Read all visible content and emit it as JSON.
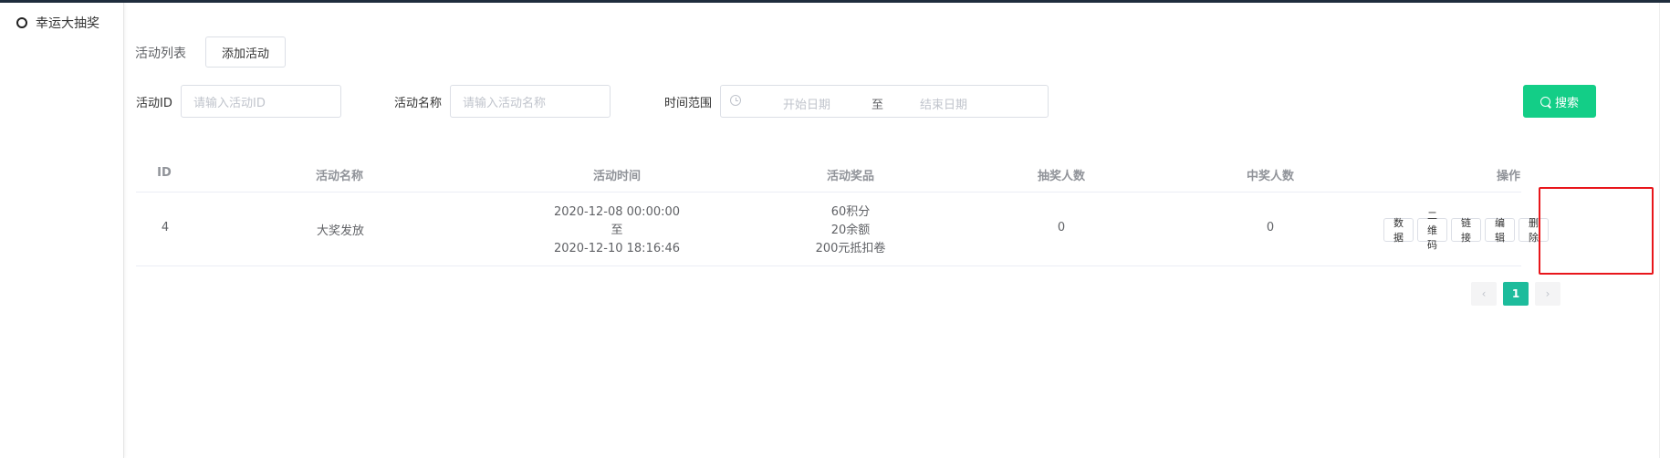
{
  "sidebar": {
    "items": [
      {
        "label": "幸运大抽奖"
      }
    ]
  },
  "header": {
    "title": "活动列表",
    "add_button": "添加活动"
  },
  "filters": {
    "id_label": "活动ID",
    "id_placeholder": "请输入活动ID",
    "name_label": "活动名称",
    "name_placeholder": "请输入活动名称",
    "time_label": "时间范围",
    "start_placeholder": "开始日期",
    "range_separator": "至",
    "end_placeholder": "结束日期",
    "search_button": "搜索"
  },
  "table": {
    "columns": [
      "ID",
      "活动名称",
      "活动时间",
      "活动奖品",
      "抽奖人数",
      "中奖人数",
      "操作"
    ],
    "rows": [
      {
        "id": "4",
        "name": "大奖发放",
        "time_start": "2020-12-08 00:00:00",
        "time_sep": "至",
        "time_end": "2020-12-10 18:16:46",
        "prize_1": "60积分",
        "prize_2": "20余额",
        "prize_3": "200元抵扣卷",
        "draw_count": "0",
        "win_count": "0",
        "actions": [
          "数据",
          "二维码",
          "链接",
          "编辑",
          "删除"
        ]
      }
    ]
  },
  "pagination": {
    "prev": "‹",
    "current": "1",
    "next": "›"
  },
  "colors": {
    "primary": "#13ce87",
    "page_active": "#1dbc9c",
    "highlight": "#e8161b"
  }
}
